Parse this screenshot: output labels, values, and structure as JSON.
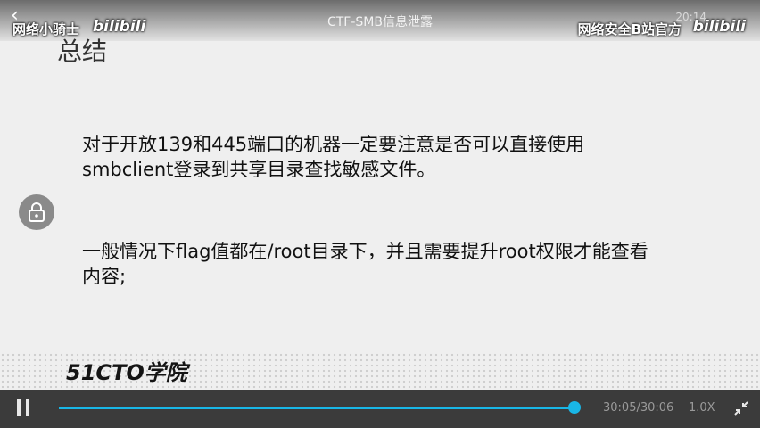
{
  "top_bar": {
    "title": "CTF-SMB信息泄露",
    "status_time": "20:14",
    "watermark_left": "网络小骑士",
    "watermark_right": "网络安全B站官方",
    "logo_text": "bilibili"
  },
  "slide": {
    "heading": "总结",
    "paragraph1": "对于开放139和445端口的机器一定要注意是否可以直接使用smbclient登录到共享目录查找敏感文件。",
    "paragraph2": "一般情况下flag值都在/root目录下，并且需要提升root权限才能查看内容;",
    "brand": "51CTO学院"
  },
  "player": {
    "time_display": "30:05/30:06",
    "speed": "1.0X",
    "progress": 0.9994,
    "accent_color": "#19b6e6"
  },
  "icons": {
    "back": "back-icon",
    "lock": "lock-icon",
    "pause": "pause-icon",
    "fullscreen": "exit-fullscreen-icon"
  }
}
